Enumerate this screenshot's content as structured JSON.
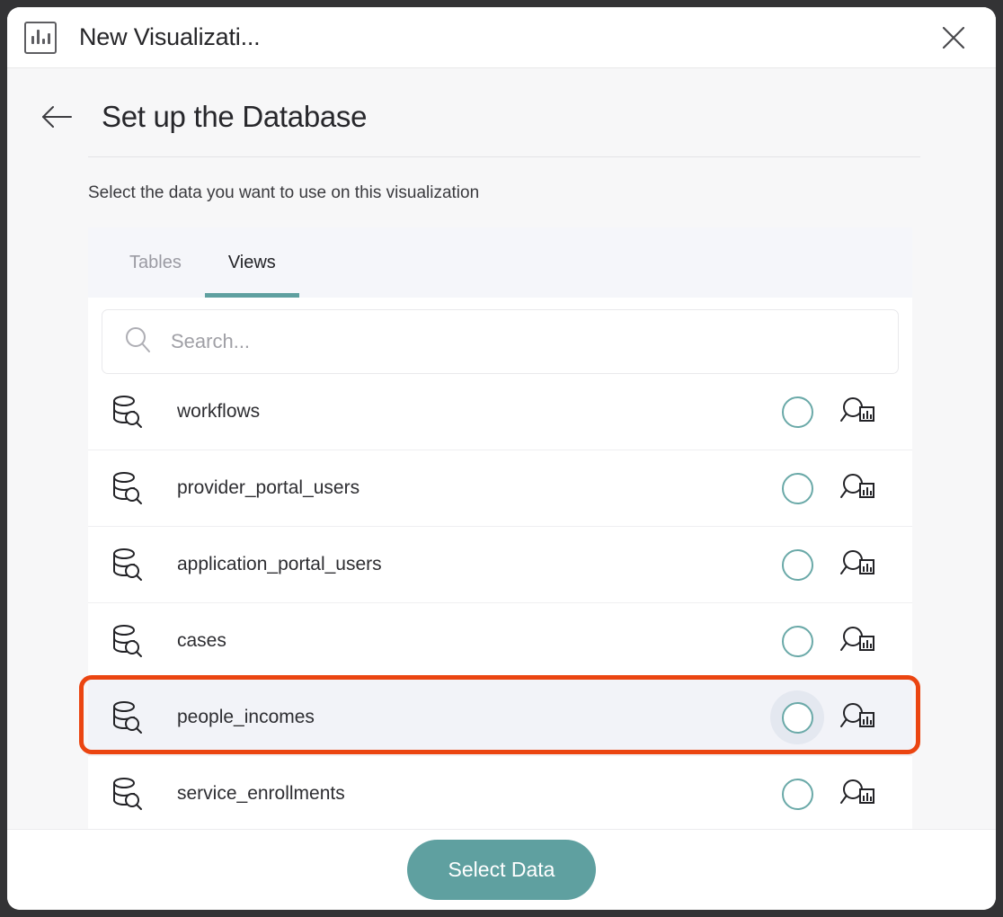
{
  "window": {
    "title": "New Visualizati...",
    "title_icon": "bar-chart-icon",
    "close_icon": "close-icon"
  },
  "step": {
    "back_icon": "arrow-left-icon",
    "title": "Set up the Database",
    "subtitle": "Select the data you want to use on this visualization"
  },
  "tabs": [
    {
      "label": "Tables",
      "active": false
    },
    {
      "label": "Views",
      "active": true
    }
  ],
  "search": {
    "icon": "search-icon",
    "placeholder": "Search...",
    "value": ""
  },
  "list": {
    "row_icon": "database-view-icon",
    "radio_icon": "radio-unchecked-icon",
    "preview_icon": "preview-data-icon",
    "items": [
      {
        "name": "workflows",
        "selected": false
      },
      {
        "name": "provider_portal_users",
        "selected": false
      },
      {
        "name": "application_portal_users",
        "selected": false
      },
      {
        "name": "cases",
        "selected": false
      },
      {
        "name": "people_incomes",
        "selected": true
      },
      {
        "name": "service_enrollments",
        "selected": false
      }
    ]
  },
  "footer": {
    "select_data_label": "Select Data"
  },
  "colors": {
    "accent_teal": "#5fa0a0",
    "annotation_red": "#eb4511",
    "tabbar_bg": "#f5f6fa",
    "selected_row_bg": "#f2f3f8",
    "page_bg": "#f7f7f8",
    "frame": "#333335"
  }
}
